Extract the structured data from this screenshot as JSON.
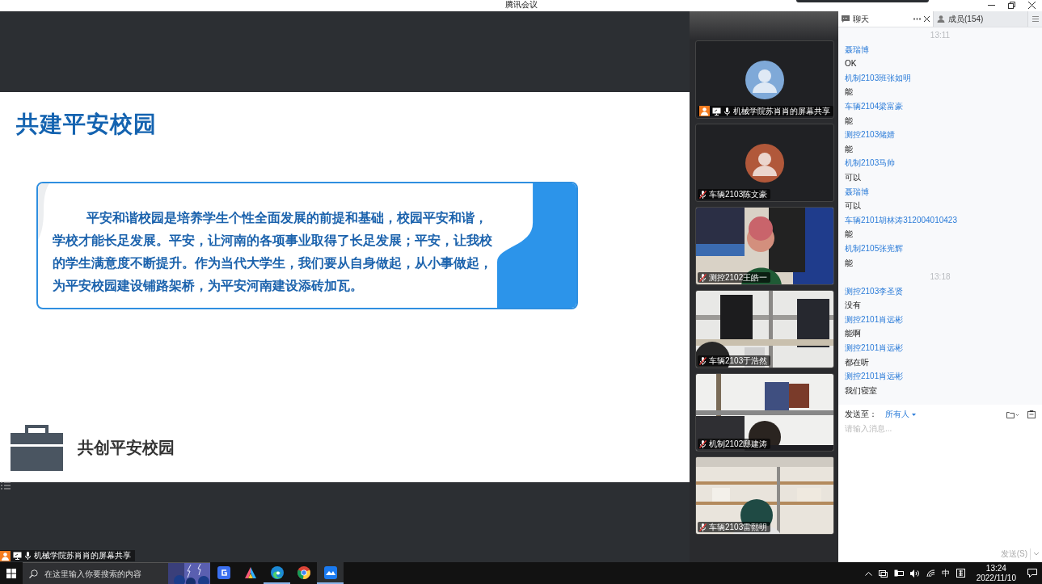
{
  "window": {
    "title": "腾讯会议"
  },
  "slide": {
    "title": "共建平安校园",
    "paragraph": "平安和谐校园是培养学生个性全面发展的前提和基础，校园平安和谐，学校才能长足发展。平安，让河南的各项事业取得了长足发展；平安，让我校的学生满意度不断提升。作为当代大学生，我们要从自身做起，从小事做起，为平安校园建设铺路架桥，为平安河南建设添砖加瓦。",
    "section_title": "共创平安校园"
  },
  "share_label": {
    "text": "机械学院苏肖肖的屏幕共享",
    "presenter": true,
    "muted": false
  },
  "video_tiles": [
    {
      "kind": "avatar",
      "name": "机械学院苏肖肖的屏幕共享",
      "presenter": true,
      "muted": false
    },
    {
      "kind": "avatar",
      "name": "车辆2103陈文豪",
      "presenter": false,
      "muted": true
    },
    {
      "kind": "picture",
      "name": "测控2102王皓一",
      "presenter": false,
      "muted": true
    },
    {
      "kind": "picture",
      "name": "车辆2103于浩然",
      "presenter": false,
      "muted": true
    },
    {
      "kind": "picture",
      "name": "机制2102邸建涛",
      "presenter": false,
      "muted": true
    },
    {
      "kind": "picture",
      "name": "车辆2103雷熙明",
      "presenter": false,
      "muted": true
    }
  ],
  "chat": {
    "tabs": [
      {
        "label": "聊天",
        "selected": true
      },
      {
        "label": "成员(154)",
        "selected": false
      }
    ],
    "entries": [
      {
        "kind": "time",
        "text": "13:11"
      },
      {
        "kind": "message",
        "sender": "聂瑞博",
        "text": "OK"
      },
      {
        "kind": "message",
        "sender": "机制2103班张如明",
        "text": "能"
      },
      {
        "kind": "message",
        "sender": "车辆2104梁富豪",
        "text": "能"
      },
      {
        "kind": "message",
        "sender": "测控2103储婧",
        "text": "能"
      },
      {
        "kind": "message",
        "sender": "机制2103马帅",
        "text": "可以"
      },
      {
        "kind": "message",
        "sender": "聂瑞博",
        "text": "可以"
      },
      {
        "kind": "message",
        "sender": "车辆2101胡林涛312004010423",
        "text": "能"
      },
      {
        "kind": "message",
        "sender": "机制2105张宪辉",
        "text": "能"
      },
      {
        "kind": "time",
        "text": "13:18"
      },
      {
        "kind": "message",
        "sender": "测控2103李圣贤",
        "text": "没有"
      },
      {
        "kind": "message",
        "sender": "测控2101肖远彬",
        "text": "能啊"
      },
      {
        "kind": "message",
        "sender": "测控2101肖远彬",
        "text": "都在听"
      },
      {
        "kind": "message",
        "sender": "测控2101肖远彬",
        "text": "我们寝室"
      }
    ],
    "send_to_label": "发送至：",
    "recipient": "所有人",
    "placeholder": "请输入消息...",
    "send_button": "发送(S)"
  },
  "taskbar": {
    "search_placeholder": "在这里输入你要搜索的内容",
    "apps": [
      {
        "kind": "box",
        "running": false,
        "selected": false
      },
      {
        "kind": "pen",
        "running": false,
        "selected": false
      },
      {
        "kind": "edge",
        "running": true,
        "selected": false
      },
      {
        "kind": "chrome",
        "running": false,
        "selected": false
      },
      {
        "kind": "meeting",
        "running": true,
        "selected": true
      }
    ],
    "ime": "中",
    "time": "13:24",
    "date": "2022/11/10"
  }
}
